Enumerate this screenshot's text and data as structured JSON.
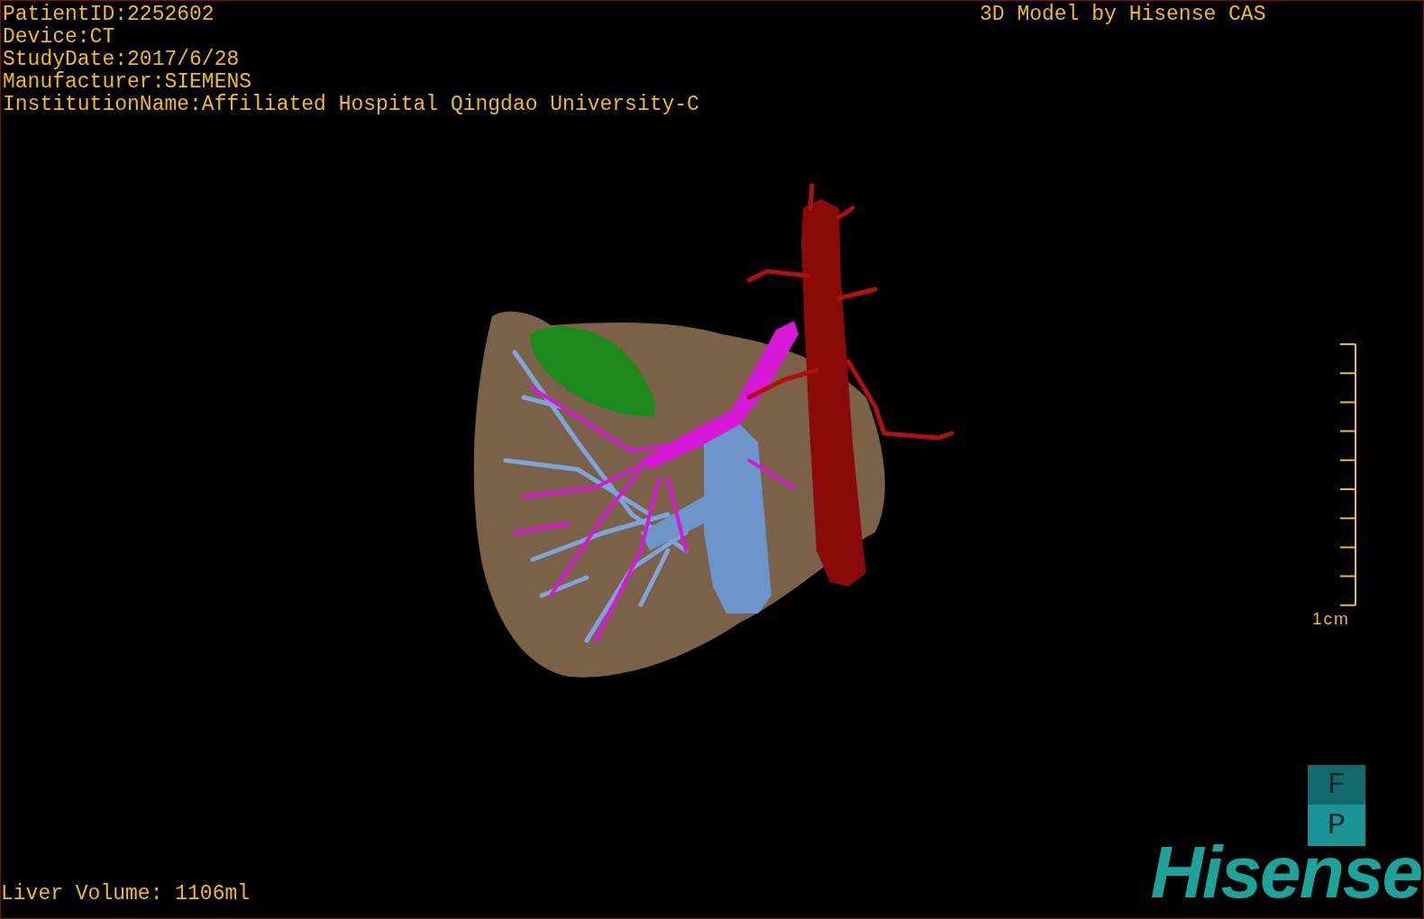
{
  "info_lines": [
    "PatientID:2252602",
    "Device:CT",
    "StudyDate:2017/6/28",
    "Manufacturer:SIEMENS",
    "InstitutionName:Affiliated Hospital Qingdao University-C"
  ],
  "title": "3D Model by Hisense CAS",
  "scale_bar": {
    "label": "1cm"
  },
  "orientation_buttons": [
    {
      "label": "F",
      "selected": false
    },
    {
      "label": "P",
      "selected": true
    }
  ],
  "liver_volume": "Liver Volume: 1106ml",
  "logo": "Hisense"
}
